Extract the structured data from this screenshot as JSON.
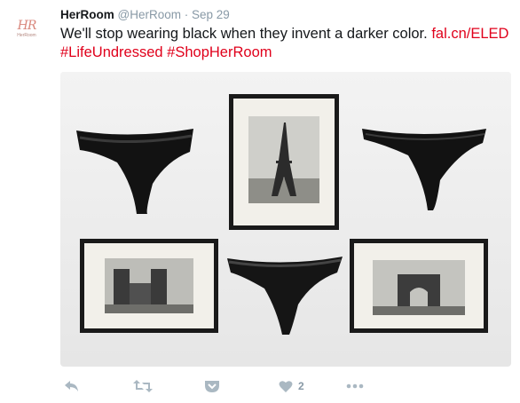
{
  "tweet": {
    "author_name": "HerRoom",
    "handle": "@HerRoom",
    "separator": "·",
    "date": "Sep 29",
    "avatar_logo": "HR",
    "avatar_text": "HerRoom",
    "text": "We'll stop wearing black when they invent a darker color.",
    "link": "fal.cn/ELED",
    "hashtags": [
      "#LifeUndressed",
      "#ShopHerRoom"
    ],
    "brand_color": "#e0001b"
  },
  "actions": {
    "reply_icon": "reply-icon",
    "retweet_icon": "retweet-icon",
    "pocket_icon": "pocket-icon",
    "like_icon": "heart-icon",
    "like_count": "2",
    "more_icon": "more-icon"
  }
}
